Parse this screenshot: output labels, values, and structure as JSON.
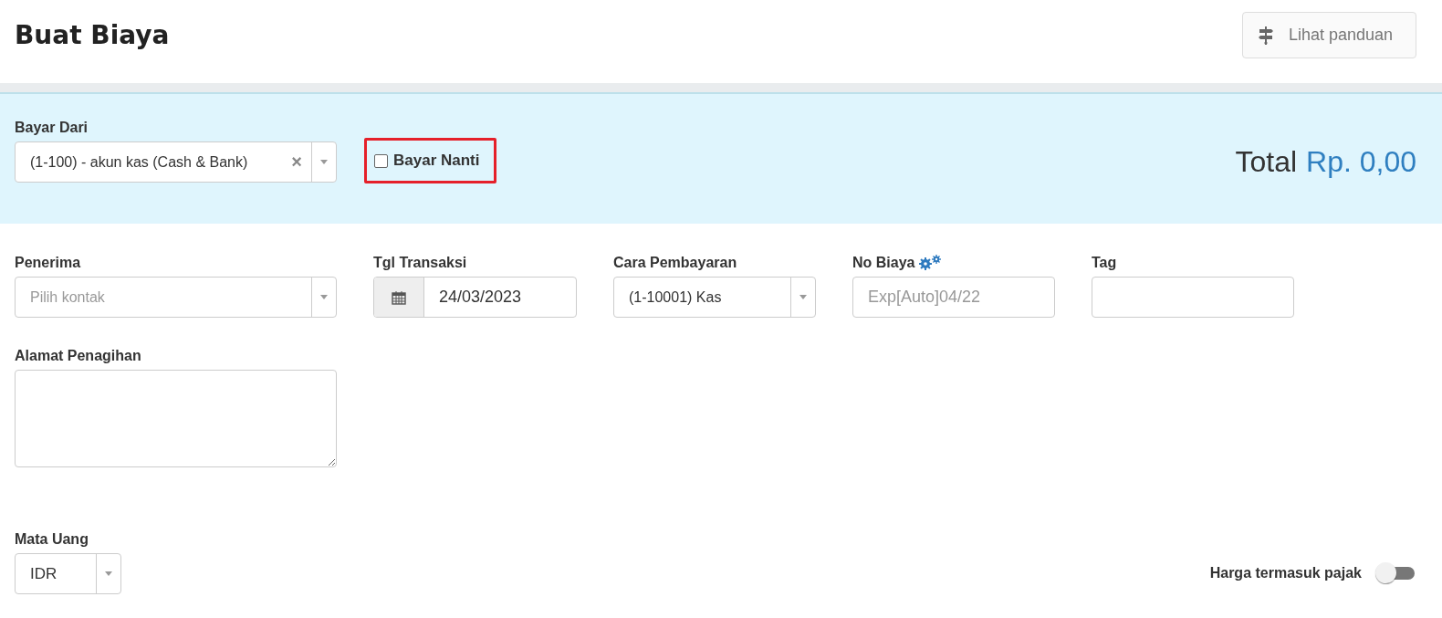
{
  "page_title": "Buat Biaya",
  "guide_button": {
    "label": "Lihat panduan"
  },
  "pay_from": {
    "label": "Bayar Dari",
    "value": "(1-100) - akun kas (Cash & Bank)",
    "clear": "×"
  },
  "pay_later": {
    "label": "Bayar Nanti",
    "checked": false
  },
  "total": {
    "label": "Total",
    "amount": "Rp. 0,00"
  },
  "fields": [
    {
      "kind": "select",
      "label": "Penerima",
      "placeholder": "Pilih kontak"
    },
    {
      "kind": "date",
      "label": "Tgl Transaksi",
      "value": "24/03/2023"
    },
    {
      "kind": "select",
      "label": "Cara Pembayaran",
      "value": "(1-10001) Kas"
    },
    {
      "kind": "auto",
      "label": "No Biaya",
      "placeholder": "Exp[Auto]04/22"
    },
    {
      "kind": "text",
      "label": "Tag"
    }
  ],
  "billing_address": {
    "label": "Alamat Penagihan"
  },
  "currency": {
    "label": "Mata Uang",
    "value": "IDR"
  },
  "tax_inclusive": {
    "label": "Harga termasuk pajak",
    "on": false
  }
}
